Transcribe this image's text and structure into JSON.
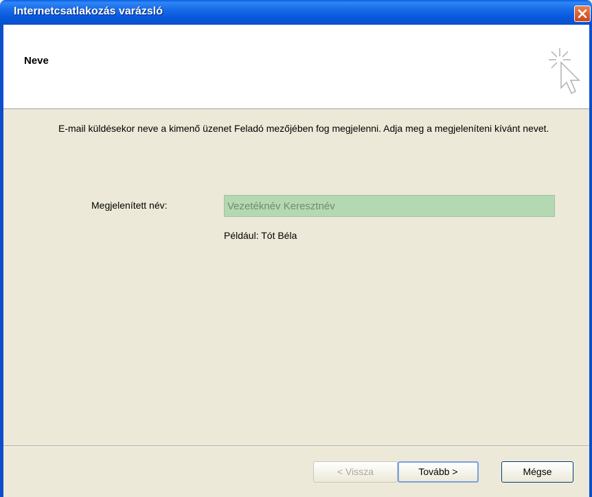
{
  "window": {
    "title": "Internetcsatlakozás varázsló"
  },
  "header": {
    "title": "Neve"
  },
  "content": {
    "description": "E-mail küldésekor neve a kimenő üzenet Feladó mezőjében fog megjelenni. Adja meg a megjeleníteni kívánt nevet.",
    "display_name_label": "Megjelenített név:",
    "display_name_value": "Vezetéknév Keresztnév",
    "example": "Például: Tót Béla"
  },
  "buttons": {
    "back": "< Vissza",
    "next": "Tovább >",
    "cancel": "Mégse"
  },
  "colors": {
    "titlebar": "#0b4fcb",
    "input_highlight": "#b4d8b1",
    "close_button": "#d75d2b"
  },
  "icons": {
    "close": "close-icon",
    "wizard": "cursor-sparkle-icon"
  }
}
